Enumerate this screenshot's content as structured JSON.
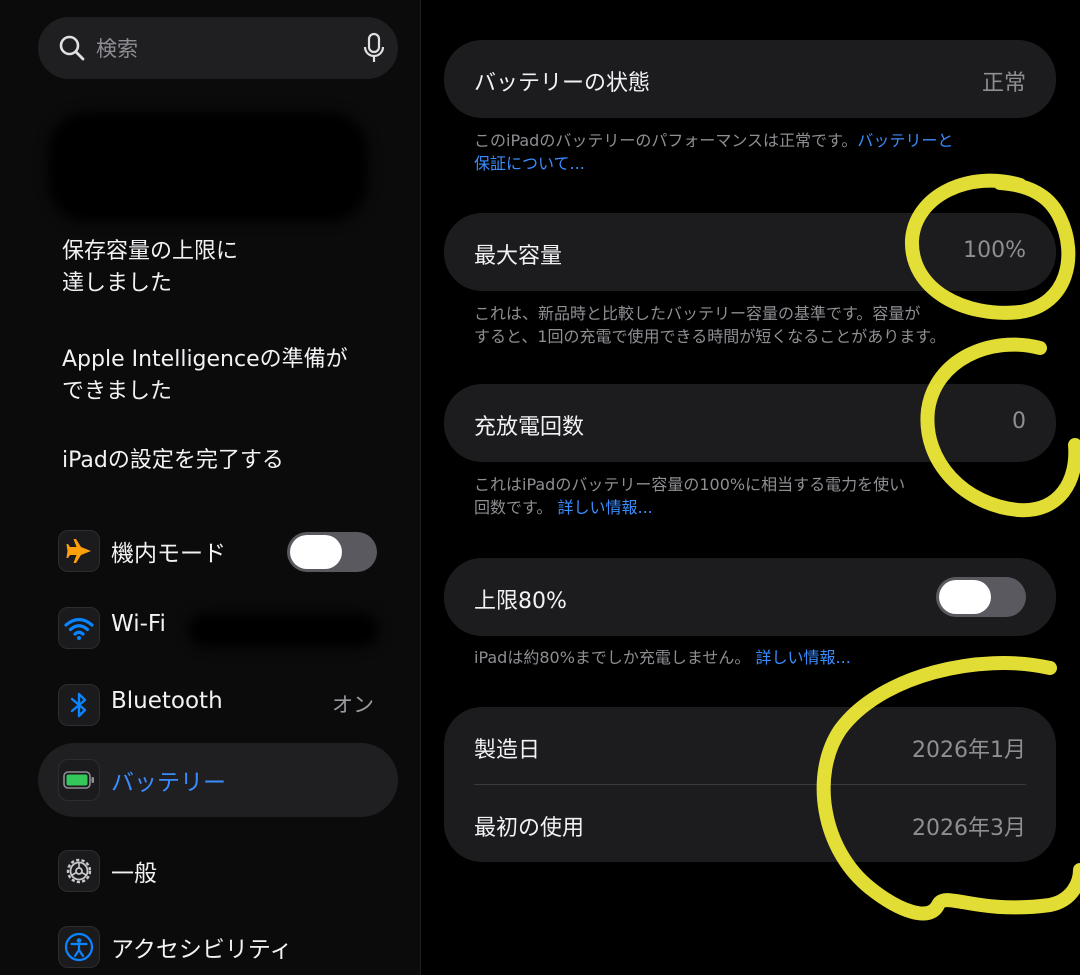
{
  "search": {
    "placeholder": "検索"
  },
  "sidebar": {
    "notices": [
      {
        "line1": "保存容量の上限に",
        "line2": "達しました"
      },
      {
        "line1": "Apple Intelligenceの準備が",
        "line2": "できました"
      },
      {
        "line1": "iPadの設定を完了する",
        "line2": ""
      }
    ],
    "items": [
      {
        "label": "機内モード",
        "icon": "airplane-icon",
        "toggle_on": false
      },
      {
        "label": "Wi-Fi",
        "icon": "wifi-icon"
      },
      {
        "label": "Bluetooth",
        "icon": "bluetooth-icon",
        "value": "オン"
      },
      {
        "label": "バッテリー",
        "icon": "battery-icon",
        "selected": true
      },
      {
        "label": "一般",
        "icon": "gear-icon"
      },
      {
        "label": "アクセシビリティ",
        "icon": "accessibility-icon"
      }
    ]
  },
  "main": {
    "health": {
      "title": "バッテリーの状態",
      "value": "正常"
    },
    "health_note": {
      "text": "このiPadのバッテリーのパフォーマンスは正常です。",
      "link1": "バッテリーと",
      "link2": "保証について..."
    },
    "capacity": {
      "title": "最大容量",
      "value": "100%"
    },
    "capacity_note": {
      "line1": "これは、新品時と比較したバッテリー容量の基準です。容量が",
      "line2": "すると、1回の充電で使用できる時間が短くなることがあります。"
    },
    "cycles": {
      "title": "充放電回数",
      "value": "0"
    },
    "cycles_note": {
      "line1": "これはiPadのバッテリー容量の100%に相当する電力を使い",
      "line2": "回数です。",
      "link": "詳しい情報..."
    },
    "limit": {
      "title": "上限80%",
      "toggle_on": false
    },
    "limit_note": {
      "text": "iPadは約80%までしか充電しません。",
      "link": "詳しい情報..."
    },
    "dates": [
      {
        "title": "製造日",
        "value": "2026年1月"
      },
      {
        "title": "最初の使用",
        "value": "2026年3月"
      }
    ]
  },
  "colors": {
    "accent": "#3a8dff",
    "annotation": "#f5f03a",
    "card": "#1c1c1e",
    "battery": "#34c759",
    "airplane": "#ff9f0a",
    "wifi": "#0a84ff"
  }
}
